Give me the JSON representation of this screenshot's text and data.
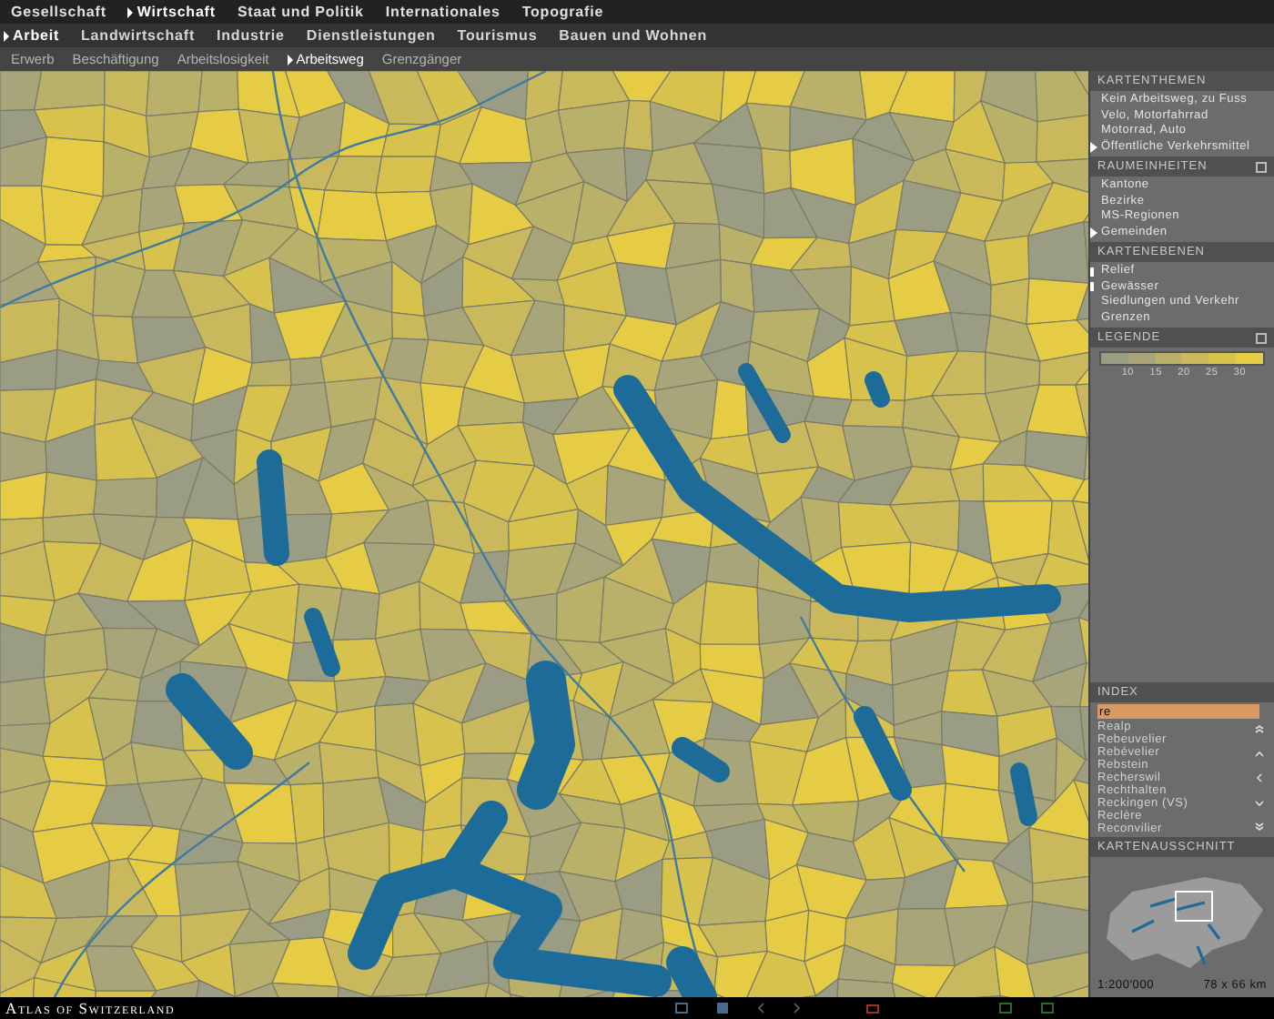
{
  "menu_level_1": [
    {
      "label": "Gesellschaft",
      "selected": false
    },
    {
      "label": "Wirtschaft",
      "selected": true
    },
    {
      "label": "Staat und Politik",
      "selected": false
    },
    {
      "label": "Internationales",
      "selected": false
    },
    {
      "label": "Topografie",
      "selected": false
    }
  ],
  "menu_level_2": [
    {
      "label": "Arbeit",
      "selected": true
    },
    {
      "label": "Landwirtschaft",
      "selected": false
    },
    {
      "label": "Industrie",
      "selected": false
    },
    {
      "label": "Dienstleistungen",
      "selected": false
    },
    {
      "label": "Tourismus",
      "selected": false
    },
    {
      "label": "Bauen und Wohnen",
      "selected": false
    }
  ],
  "menu_level_3": [
    {
      "label": "Erwerb",
      "selected": false
    },
    {
      "label": "Beschäftigung",
      "selected": false
    },
    {
      "label": "Arbeitslosigkeit",
      "selected": false
    },
    {
      "label": "Arbeitsweg",
      "selected": true
    },
    {
      "label": "Grenzgänger",
      "selected": false
    }
  ],
  "kartenthemen": {
    "title": "KARTENTHEMEN",
    "items": [
      {
        "label": "Kein Arbeitsweg, zu Fuss",
        "selected": false
      },
      {
        "label": "Velo, Motorfahrrad",
        "selected": false
      },
      {
        "label": "Motorrad, Auto",
        "selected": false
      },
      {
        "label": "Öffentliche Verkehrsmittel",
        "selected": true
      }
    ]
  },
  "raumeinheiten": {
    "title": "RAUMEINHEITEN",
    "items": [
      {
        "label": "Kantone",
        "selected": false
      },
      {
        "label": "Bezirke",
        "selected": false
      },
      {
        "label": "MS-Regionen",
        "selected": false
      },
      {
        "label": "Gemeinden",
        "selected": true
      }
    ]
  },
  "kartenebenen": {
    "title": "KARTENEBENEN",
    "items": [
      {
        "label": "Relief",
        "checked": true
      },
      {
        "label": "Gewässer",
        "checked": true
      },
      {
        "label": "Siedlungen und Verkehr",
        "checked": false
      },
      {
        "label": "Grenzen",
        "checked": false
      }
    ]
  },
  "legende": {
    "title": "LEGENDE",
    "bins": [
      {
        "color": "#9a9c84"
      },
      {
        "color": "#a8a57a"
      },
      {
        "color": "#b9b06a"
      },
      {
        "color": "#c9b95c"
      },
      {
        "color": "#d8c24e"
      },
      {
        "color": "#e6cc44"
      }
    ],
    "labels": [
      "10",
      "15",
      "20",
      "25",
      "30"
    ]
  },
  "index": {
    "title": "INDEX",
    "query": "re",
    "items": [
      "Realp",
      "Rebeuvelier",
      "Rebévelier",
      "Rebstein",
      "Recherswil",
      "Rechthalten",
      "Reckingen (VS)",
      "Reclère",
      "Reconvilier"
    ]
  },
  "kartenausschnitt": {
    "title": "KARTENAUSSCHNITT",
    "scale": "1:200'000",
    "extent": "78 x 66 km"
  },
  "footer": {
    "brand": "Atlas of Switzerland"
  }
}
